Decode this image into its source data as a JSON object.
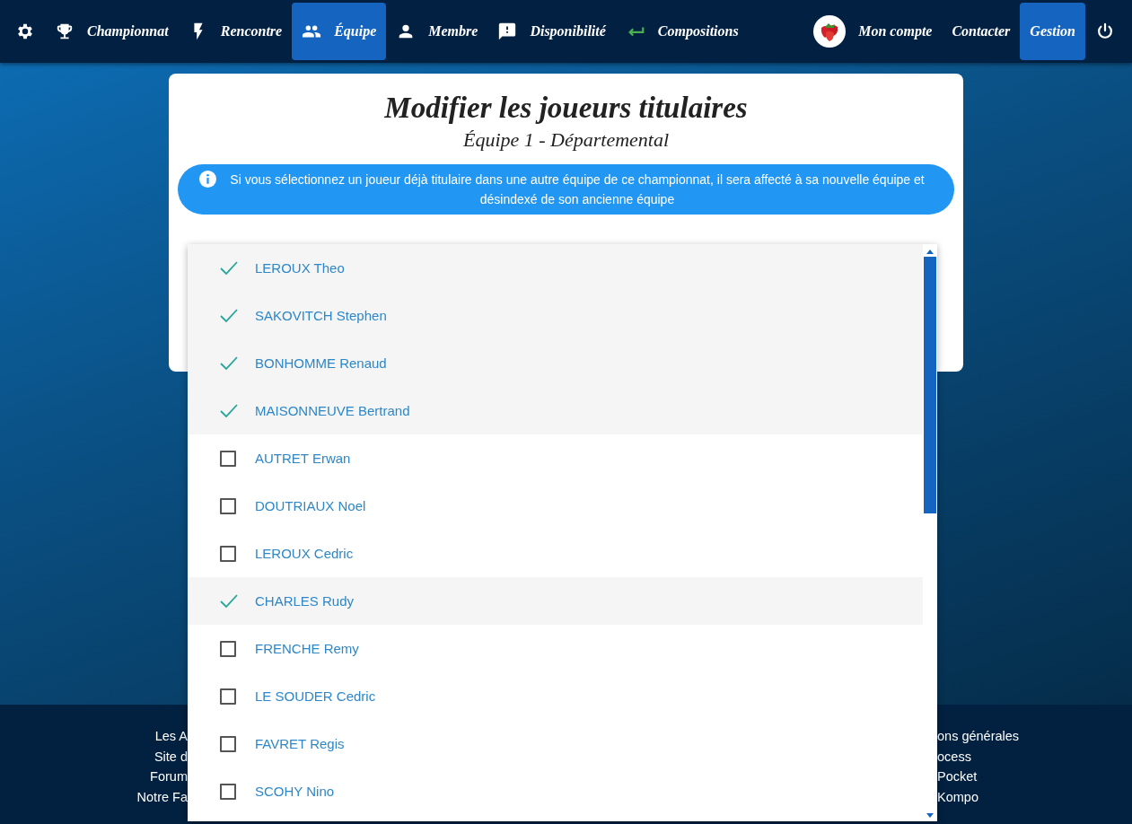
{
  "nav": {
    "left": [
      {
        "kind": "gear",
        "selected": false
      },
      {
        "kind": "trophy",
        "label": "Championnat",
        "selected": false
      },
      {
        "kind": "bolt",
        "label": "Rencontre",
        "selected": false
      },
      {
        "kind": "group",
        "label": "Équipe",
        "selected": true
      },
      {
        "kind": "person",
        "label": "Membre",
        "selected": false
      },
      {
        "kind": "alert",
        "label": "Disponibilité",
        "selected": false
      },
      {
        "kind": "return",
        "label": "Compositions",
        "selected": false
      }
    ],
    "right": [
      {
        "kind": "avatar",
        "label": "Mon compte",
        "selected": false
      },
      {
        "kind": "text",
        "label": "Contacter",
        "selected": false
      },
      {
        "kind": "text",
        "label": "Gestion",
        "selected": true
      },
      {
        "kind": "power",
        "selected": false
      }
    ]
  },
  "card": {
    "title": "Modifier les joueurs titulaires",
    "subtitle": "Équipe 1 - Départemental",
    "info": "Si vous sélectionnez un joueur déjà titulaire dans une autre équipe de ce championnat, il sera affecté à sa nouvelle équipe et désindexé de son ancienne équipe"
  },
  "players": [
    {
      "name": "LEROUX Theo",
      "checked": true
    },
    {
      "name": "SAKOVITCH Stephen",
      "checked": true
    },
    {
      "name": "BONHOMME Renaud",
      "checked": true
    },
    {
      "name": "MAISONNEUVE Bertrand",
      "checked": true
    },
    {
      "name": "AUTRET Erwan",
      "checked": false
    },
    {
      "name": "DOUTRIAUX Noel",
      "checked": false
    },
    {
      "name": "LEROUX Cedric",
      "checked": false
    },
    {
      "name": "CHARLES Rudy",
      "checked": true
    },
    {
      "name": "FRENCHE Remy",
      "checked": false
    },
    {
      "name": "LE SOUDER Cedric",
      "checked": false
    },
    {
      "name": "FAVRET Regis",
      "checked": false
    },
    {
      "name": "SCOHY Nino",
      "checked": false
    }
  ],
  "footer": {
    "left": [
      "Les A",
      "Site d",
      "Forum",
      "Notre Fa"
    ],
    "right": [
      "ons générales",
      "ocess",
      "Pocket",
      "Kompo"
    ]
  }
}
